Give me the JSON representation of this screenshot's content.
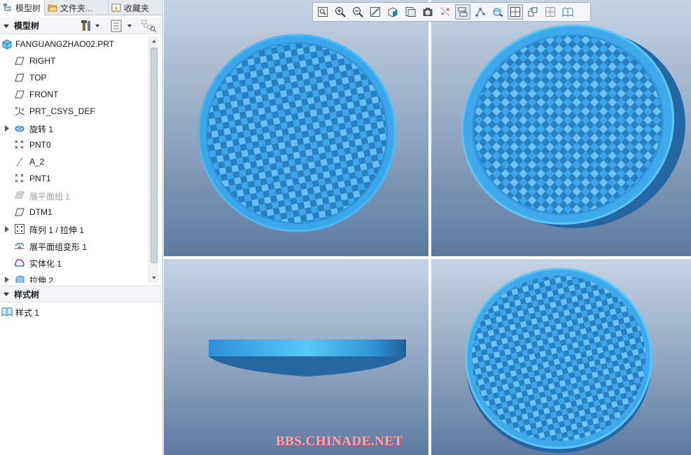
{
  "tabs": [
    {
      "label": "模型树",
      "icon": "model-tree-icon",
      "active": true
    },
    {
      "label": "文件夹...",
      "icon": "folder-icon",
      "active": false
    },
    {
      "label": "收藏夹",
      "icon": "favorites-icon",
      "active": false
    }
  ],
  "model_tree": {
    "title": "模型树",
    "items": [
      {
        "label": "FANGUANGZHAO02.PRT",
        "icon": "part-icon",
        "expandable": false,
        "disabled": false
      },
      {
        "label": "RIGHT",
        "icon": "datum-plane-icon",
        "expandable": false,
        "disabled": false
      },
      {
        "label": "TOP",
        "icon": "datum-plane-icon",
        "expandable": false,
        "disabled": false
      },
      {
        "label": "FRONT",
        "icon": "datum-plane-icon",
        "expandable": false,
        "disabled": false
      },
      {
        "label": "PRT_CSYS_DEF",
        "icon": "coordinate-system-icon",
        "expandable": false,
        "disabled": false
      },
      {
        "label": "旋转 1",
        "icon": "revolve-icon",
        "expandable": true,
        "disabled": false
      },
      {
        "label": "PNT0",
        "icon": "datum-point-icon",
        "expandable": false,
        "disabled": false
      },
      {
        "label": "A_2",
        "icon": "datum-axis-icon",
        "expandable": false,
        "disabled": false
      },
      {
        "label": "PNT1",
        "icon": "datum-point-icon",
        "expandable": false,
        "disabled": false
      },
      {
        "label": "展平面组 1",
        "icon": "flatten-quilt-icon",
        "expandable": false,
        "disabled": true
      },
      {
        "label": "DTM1",
        "icon": "datum-plane-icon",
        "expandable": false,
        "disabled": false
      },
      {
        "label": "阵列 1 / 拉伸 1",
        "icon": "pattern-icon",
        "expandable": true,
        "disabled": false
      },
      {
        "label": "展平面组变形 1",
        "icon": "flatten-deform-icon",
        "expandable": false,
        "disabled": false
      },
      {
        "label": "实体化 1",
        "icon": "solidify-icon",
        "expandable": false,
        "disabled": false
      },
      {
        "label": "拉伸 2",
        "icon": "extrude-icon",
        "expandable": true,
        "disabled": false
      }
    ]
  },
  "style_tree": {
    "title": "样式树",
    "items": [
      {
        "label": "样式 1",
        "icon": "style-icon"
      }
    ]
  },
  "view_toolbar": {
    "buttons": [
      {
        "name": "refit-icon"
      },
      {
        "name": "zoom-in-icon"
      },
      {
        "name": "zoom-out-icon"
      },
      {
        "name": "repaint-icon"
      },
      {
        "name": "shading-icon"
      },
      {
        "name": "saved-views-icon"
      },
      {
        "name": "view-manager-icon"
      },
      {
        "name": "plane-display-icon"
      },
      {
        "name": "axis-display-icon",
        "pressed": true
      },
      {
        "name": "point-display-icon"
      },
      {
        "name": "csys-display-icon"
      },
      {
        "name": "four-view-icon",
        "pressed": true
      },
      {
        "name": "reorient-icon"
      },
      {
        "name": "split-view-icon"
      },
      {
        "name": "section-view-icon"
      }
    ]
  },
  "watermark": "BBS.CHINADE.NET",
  "colors": {
    "part_fill": "#3ca6ea",
    "part_rim": "#55c2f7",
    "part_shadow": "#2673b0",
    "viewport_top": "#c6d3e3",
    "viewport_bottom": "#5d7aa0",
    "watermark": "#f4a7b4"
  }
}
